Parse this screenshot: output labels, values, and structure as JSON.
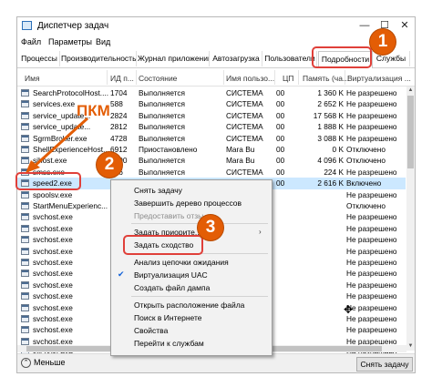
{
  "window": {
    "title": "Диспетчер задач",
    "minimize": "—",
    "maximize": "☐",
    "close": "✕"
  },
  "menubar": [
    "Файл",
    "Параметры",
    "Вид"
  ],
  "tabs": [
    "Процессы",
    "Производительность",
    "Журнал приложений",
    "Автозагрузка",
    "Пользователи",
    "Подробности",
    "Службы"
  ],
  "active_tab": "Подробности",
  "columns": [
    "Имя",
    "ИД п...",
    "Состояние",
    "Имя пользо...",
    "ЦП",
    "Память (ча...",
    "Виртуализация ..."
  ],
  "rows": [
    {
      "name": "SearchProtocolHost....",
      "pid": "1704",
      "state": "Выполняется",
      "user": "СИСТЕМА",
      "cpu": "00",
      "mem": "1 360 K",
      "virt": "Не разрешено"
    },
    {
      "name": "services.exe",
      "pid": "588",
      "state": "Выполняется",
      "user": "СИСТЕМА",
      "cpu": "00",
      "mem": "2 652 K",
      "virt": "Не разрешено"
    },
    {
      "name": "service_update...",
      "pid": "2824",
      "state": "Выполняется",
      "user": "СИСТЕМА",
      "cpu": "00",
      "mem": "17 568 K",
      "virt": "Не разрешено"
    },
    {
      "name": "service_update...",
      "pid": "2812",
      "state": "Выполняется",
      "user": "СИСТЕМА",
      "cpu": "00",
      "mem": "1 888 K",
      "virt": "Не разрешено"
    },
    {
      "name": "SgrmBroker.exe",
      "pid": "4728",
      "state": "Выполняется",
      "user": "СИСТЕМА",
      "cpu": "00",
      "mem": "3 088 K",
      "virt": "Не разрешено"
    },
    {
      "name": "ShellExperienceHost...",
      "pid": "6912",
      "state": "Приостановлено",
      "user": "Mara Bu",
      "cpu": "00",
      "mem": "0 K",
      "virt": "Отключено"
    },
    {
      "name": "sihost.exe",
      "pid": "6800",
      "state": "Выполняется",
      "user": "Mara Bu",
      "cpu": "00",
      "mem": "4 096 K",
      "virt": "Отключено"
    },
    {
      "name": "smss.exe",
      "pid": "316",
      "state": "Выполняется",
      "user": "СИСТЕМА",
      "cpu": "00",
      "mem": "224 K",
      "virt": "Не разрешено"
    },
    {
      "name": "speed2.exe",
      "pid": "8548",
      "state": "Выполняется",
      "user": "Mara Bu",
      "cpu": "00",
      "mem": "2 616 K",
      "virt": "Включено"
    },
    {
      "name": "spoolsv.exe",
      "pid": "",
      "state": "",
      "user": "",
      "cpu": "",
      "mem": "",
      "virt": "Не разрешено"
    },
    {
      "name": "StartMenuExperienc...",
      "pid": "",
      "state": "",
      "user": "",
      "cpu": "",
      "mem": "",
      "virt": "Отключено"
    },
    {
      "name": "svchost.exe",
      "pid": "",
      "state": "",
      "user": "",
      "cpu": "",
      "mem": "",
      "virt": "Не разрешено"
    },
    {
      "name": "svchost.exe",
      "pid": "",
      "state": "",
      "user": "",
      "cpu": "",
      "mem": "",
      "virt": "Не разрешено"
    },
    {
      "name": "svchost.exe",
      "pid": "",
      "state": "",
      "user": "",
      "cpu": "",
      "mem": "",
      "virt": "Не разрешено"
    },
    {
      "name": "svchost.exe",
      "pid": "",
      "state": "",
      "user": "",
      "cpu": "",
      "mem": "",
      "virt": "Не разрешено"
    },
    {
      "name": "svchost.exe",
      "pid": "",
      "state": "",
      "user": "",
      "cpu": "",
      "mem": "",
      "virt": "Не разрешено"
    },
    {
      "name": "svchost.exe",
      "pid": "",
      "state": "",
      "user": "",
      "cpu": "",
      "mem": "",
      "virt": "Не разрешено"
    },
    {
      "name": "svchost.exe",
      "pid": "",
      "state": "",
      "user": "",
      "cpu": "",
      "mem": "",
      "virt": "Не разрешено"
    },
    {
      "name": "svchost.exe",
      "pid": "",
      "state": "",
      "user": "",
      "cpu": "",
      "mem": "",
      "virt": "Не разрешено"
    },
    {
      "name": "svchost.exe",
      "pid": "",
      "state": "",
      "user": "",
      "cpu": "",
      "mem": "",
      "virt": "Не разрешено"
    },
    {
      "name": "svchost.exe",
      "pid": "",
      "state": "",
      "user": "",
      "cpu": "",
      "mem": "",
      "virt": "Не разрешено"
    },
    {
      "name": "svchost.exe",
      "pid": "",
      "state": "",
      "user": "",
      "cpu": "",
      "mem": "",
      "virt": "Не разрешено"
    },
    {
      "name": "svchost.exe",
      "pid": "",
      "state": "",
      "user": "",
      "cpu": "",
      "mem": "",
      "virt": "Не разрешено"
    },
    {
      "name": "svchost.exe",
      "pid": "",
      "state": "",
      "user": "",
      "cpu": "",
      "mem": "",
      "virt": "Не разрешено"
    }
  ],
  "selected_row": "speed2.exe",
  "context_menu": {
    "end_task": "Снять задачу",
    "end_tree": "Завершить дерево процессов",
    "give_feedback": "Предоставить отзы...",
    "set_priority": "Задать приорите...",
    "set_affinity": "Задать сходство",
    "wait_chain": "Анализ цепочки ожидания",
    "uac_virt": "Виртуализация UAC",
    "dump": "Создать файл дампа",
    "open_location": "Открыть расположение файла",
    "search_online": "Поиск в Интернете",
    "properties": "Свойства",
    "goto_services": "Перейти к службам"
  },
  "footer": {
    "less": "Меньше",
    "end_task_button": "Снять задачу"
  },
  "annotations": {
    "step1": "1",
    "step2": "2",
    "step3": "3",
    "label_pkm": "ПКМ"
  },
  "colors": {
    "accent_badge": "#e35d05",
    "highlight": "#e0403a",
    "selection": "#cce8ff"
  }
}
